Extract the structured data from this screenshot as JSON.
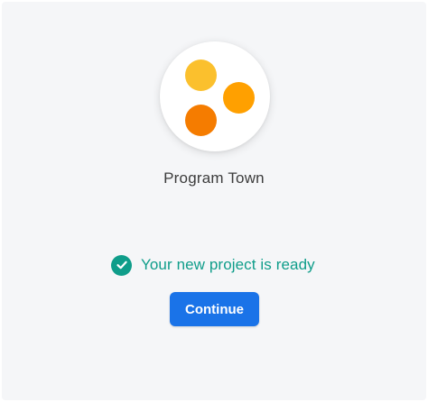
{
  "org": {
    "name": "Program Town"
  },
  "logo": {
    "dot_colors": [
      "#fbc02d",
      "#ffa000",
      "#f57c00"
    ]
  },
  "status": {
    "icon": "check-circle-icon",
    "text": "Your new project is ready",
    "color": "#0f9d8a"
  },
  "actions": {
    "continue_label": "Continue",
    "continue_color": "#1a73e8"
  }
}
